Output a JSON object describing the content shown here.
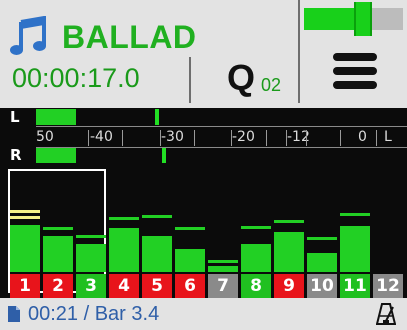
{
  "song": {
    "title": "BALLAD",
    "time": "00:00:17.0"
  },
  "quick": {
    "letter": "Q",
    "number": "02"
  },
  "volume": {
    "level": 0.62
  },
  "meter": {
    "channels": [
      {
        "label": "L",
        "level_db": -48,
        "peak_db": -31
      },
      {
        "label": "R",
        "level_db": -48,
        "peak_db": -30
      }
    ],
    "scale": [
      {
        "label": "50"
      },
      {
        "label": "-40"
      },
      {
        "label": "-30"
      },
      {
        "label": "-20"
      },
      {
        "label": "-12"
      },
      {
        "label": "0"
      },
      {
        "label": "L"
      }
    ]
  },
  "mixer": {
    "selected": [
      1,
      2,
      3
    ],
    "channels": [
      {
        "num": "1",
        "level": 0.62,
        "volume": 0.7,
        "peak": 0.78,
        "label_color": "#e8141b"
      },
      {
        "num": "2",
        "level": 0.47,
        "volume": 0.55,
        "peak": 0.55,
        "label_color": "#e8141b"
      },
      {
        "num": "3",
        "level": 0.37,
        "volume": 0.45,
        "peak": 0.45,
        "label_color": "#20c020"
      },
      {
        "num": "4",
        "level": 0.58,
        "volume": 0.68,
        "peak": 0.68,
        "label_color": "#e8141b"
      },
      {
        "num": "5",
        "level": 0.48,
        "volume": 0.71,
        "peak": 0.71,
        "label_color": "#e8141b"
      },
      {
        "num": "6",
        "level": 0.3,
        "volume": 0.55,
        "peak": 0.55,
        "label_color": "#e8141b"
      },
      {
        "num": "7",
        "level": 0.08,
        "volume": 0.12,
        "peak": 0.12,
        "label_color": "#8a8a8a"
      },
      {
        "num": "8",
        "level": 0.37,
        "volume": 0.57,
        "peak": 0.57,
        "label_color": "#20c020"
      },
      {
        "num": "9",
        "level": 0.52,
        "volume": 0.64,
        "peak": 0.64,
        "label_color": "#e8141b"
      },
      {
        "num": "10",
        "level": 0.25,
        "volume": 0.42,
        "peak": 0.42,
        "label_color": "#8a8a8a"
      },
      {
        "num": "11",
        "level": 0.6,
        "volume": 0.74,
        "peak": 0.74,
        "label_color": "#20c020"
      },
      {
        "num": "12",
        "level": 0.0,
        "volume": 0.0,
        "peak": 0.0,
        "label_color": "#8a8a8a"
      }
    ]
  },
  "status": {
    "position": "00:21 / Bar 3.4"
  },
  "colors": {
    "accent_green": "#20b020",
    "meter_green": "#22d024",
    "peak_yellow": "#f5f08a",
    "status_blue": "#2f5fa8"
  }
}
